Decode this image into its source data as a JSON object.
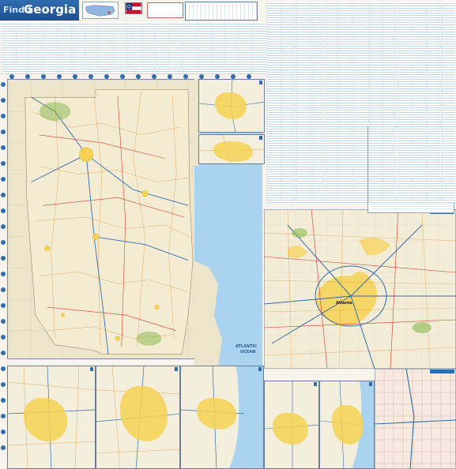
{
  "header": {
    "brand": "FindIt",
    "title": "Georgia"
  },
  "maps": {
    "main_label_ocean_1": "ATLANTIC",
    "main_label_ocean_2": "OCEAN",
    "atlanta_center": "Atlanta"
  },
  "colors": {
    "banner": "#1d4f8e",
    "urban_area": "#f5d253",
    "ocean": "#a9d3ef",
    "land": "#efe8d2",
    "interstate": "#2f6db0",
    "highway": "#d23b2f",
    "road": "#e08a2a"
  },
  "icons": {
    "us_locator": "us-locator-map-icon",
    "state_flag": "georgia-flag-icon"
  }
}
